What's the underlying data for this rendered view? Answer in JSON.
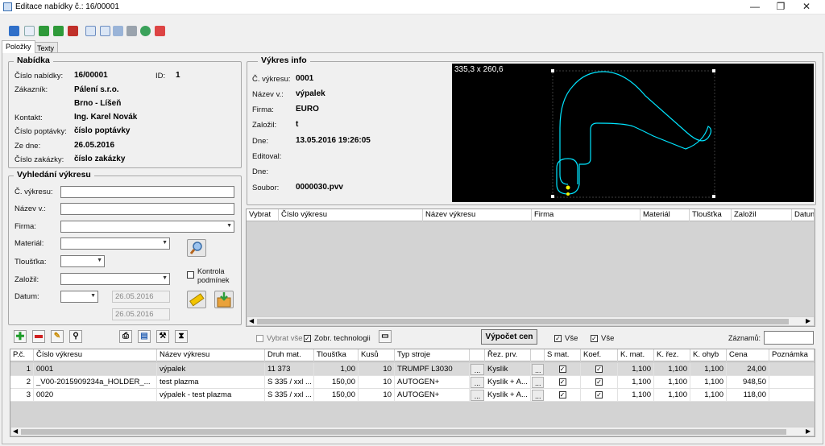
{
  "window": {
    "title": "Editace nabídky č.: 16/00001",
    "minimize": "—",
    "restore": "❐",
    "close": "✕"
  },
  "toolbar": {
    "icons": [
      "back-arrow-icon",
      "new-doc-icon",
      "save-icon",
      "save-close-icon",
      "delete-icon",
      "search-doc-icon",
      "search-doc2-icon",
      "find-icon",
      "print-icon",
      "globe-icon",
      "export-icon"
    ]
  },
  "tabs": [
    "Položky",
    "Texty"
  ],
  "nabidka": {
    "title": "Nabídka",
    "cislo_label": "Číslo nabídky:",
    "cislo_value": "16/00001",
    "id_label": "ID:",
    "id_value": "1",
    "zakaznik_label": "Zákazník:",
    "zakaznik_value": "Pálení s.r.o.",
    "zakaznik_city": "Brno - Líšeň",
    "kontakt_label": "Kontakt:",
    "kontakt_value": "Ing. Karel Novák",
    "poptavka_label": "Číslo poptávky:",
    "poptavka_value": "číslo poptávky",
    "ze_dne_label": "Ze dne:",
    "ze_dne_value": "26.05.2016",
    "zakazka_label": "Číslo zakázky:",
    "zakazka_value": "číslo zakázky"
  },
  "search": {
    "title": "Vyhledání výkresu",
    "c_vykresu": "Č. výkresu:",
    "nazev": "Název v.:",
    "firma": "Firma:",
    "material": "Materiál:",
    "tloustka": "Tloušťka:",
    "zalozil": "Založil:",
    "datum": "Datum:",
    "date_from": "26.05.2016",
    "date_to": "26.05.2016",
    "kontrola": "Kontrola podmínek"
  },
  "vykres": {
    "title": "Výkres info",
    "c_label": "Č. výkresu:",
    "c_value": "0001",
    "nazev_label": "Název v.:",
    "nazev_value": "výpalek",
    "firma_label": "Firma:",
    "firma_value": "EURO",
    "zalozil_label": "Založil:",
    "zalozil_value": "t",
    "dne_label": "Dne:",
    "dne_value": "13.05.2016 19:26:05",
    "editoval_label": "Editoval:",
    "editoval_value": "",
    "dne2_label": "Dne:",
    "dne2_value": "",
    "soubor_label": "Soubor:",
    "soubor_value": "0000030.pvv",
    "dimensions": "335,3 x 260,6"
  },
  "drawings_grid": {
    "columns": [
      "Vybrat",
      "Číslo výkresu",
      "Název výkresu",
      "Firma",
      "Materiál",
      "Tloušťka",
      "Založil",
      "Datum"
    ]
  },
  "actions": {
    "vybrat_vse": "Vybrat vše",
    "zobr_tech": "Zobr. technologii",
    "vypocet": "Výpočet cen",
    "vse1": "Vše",
    "vse2": "Vše",
    "zaznamu": "Záznamů:"
  },
  "items_grid": {
    "columns": [
      "P.č.",
      "Číslo výkresu",
      "Název výkresu",
      "Druh mat.",
      "Tloušťka",
      "Kusů",
      "Typ stroje",
      "",
      "Řez. prv.",
      "",
      "S mat.",
      "Koef.",
      "K. mat.",
      "K. řez.",
      "K. ohyb",
      "Cena",
      "Poznámka"
    ],
    "rows": [
      {
        "pc": "1",
        "cislo": "0001",
        "nazev": "výpalek",
        "druh": "11 373",
        "tloustka": "1,00",
        "kusu": "10",
        "typ": "TRUMPF L3030",
        "rez": "Kyslík",
        "kmat": "1,100",
        "krez": "1,100",
        "kohyb": "1,100",
        "cena": "24,00",
        "poznamka": ""
      },
      {
        "pc": "2",
        "cislo": "_V00-2015909234a_HOLDER_...",
        "nazev": "test plazma",
        "druh": "S 335 / xxl ...",
        "tloustka": "150,00",
        "kusu": "10",
        "typ": "AUTOGEN+",
        "rez": "Kyslík + A...",
        "kmat": "1,100",
        "krez": "1,100",
        "kohyb": "1,100",
        "cena": "948,50",
        "poznamka": ""
      },
      {
        "pc": "3",
        "cislo": "0020",
        "nazev": "výpalek - test plazma",
        "druh": "S 335 / xxl ...",
        "tloustka": "150,00",
        "kusu": "10",
        "typ": "AUTOGEN+",
        "rez": "Kyslík + A...",
        "kmat": "1,100",
        "krez": "1,100",
        "kohyb": "1,100",
        "cena": "118,00",
        "poznamka": ""
      }
    ]
  },
  "colors": {
    "accent": "#3a7bd5",
    "preview_bg": "#000000",
    "drawing_line": "#00e5ff"
  }
}
